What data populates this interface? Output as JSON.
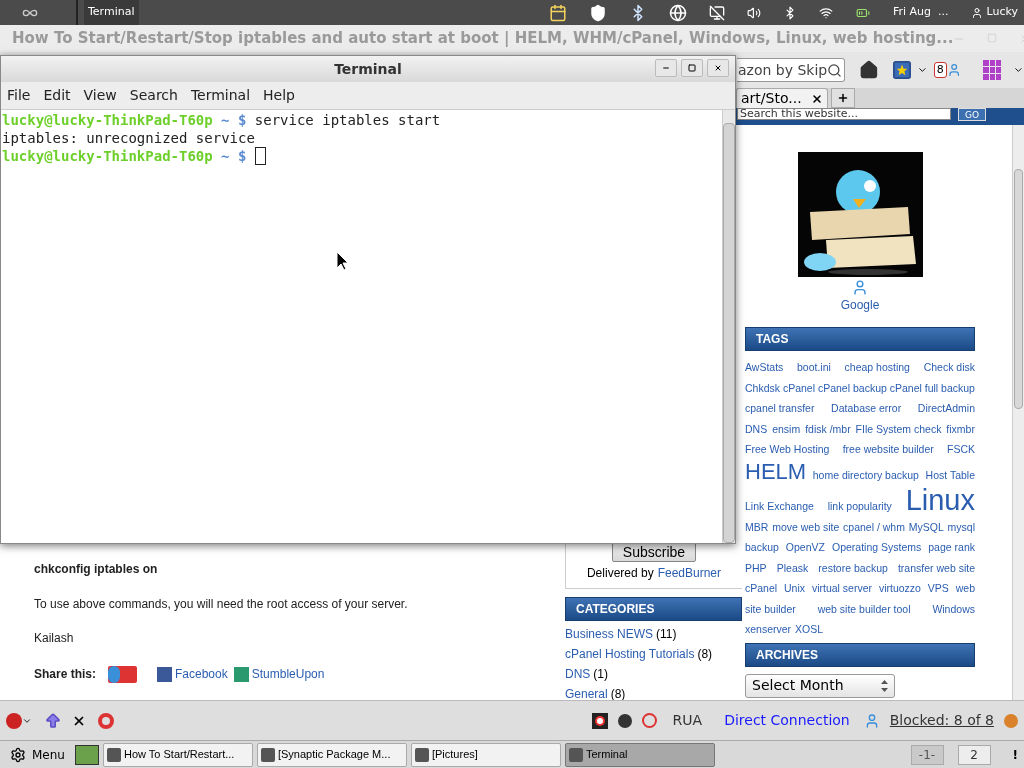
{
  "top_panel": {
    "active_app": "Terminal",
    "clock": "Fri Aug  ...",
    "user": "Lucky"
  },
  "browser": {
    "title": "How To Start/Restart/Stop iptables and auto start at boot | HELM, WHM/cPanel, Windows, Linux, web hosting...",
    "search_value": "azon by Skip",
    "badge": "8",
    "tabs": [
      {
        "label": "art/Sto...",
        "selected": true
      }
    ],
    "site_search": {
      "placeholder": "Search this website...",
      "button": "GO"
    }
  },
  "article": {
    "command": "chkconfig iptables on",
    "paragraph": "To use above commands, you will need the root access of your server.",
    "author": "Kailash",
    "share_label": "Share this:",
    "share_links": [
      "Facebook",
      "StumbleUpon"
    ]
  },
  "feed": {
    "button": "Subscribe",
    "delivered_by": "Delivered by",
    "feed_link": "FeedBurner"
  },
  "categories": {
    "heading": "CATEGORIES",
    "items": [
      {
        "name": "Business NEWS",
        "count": "(11)"
      },
      {
        "name": "cPanel Hosting Tutorials",
        "count": "(8)"
      },
      {
        "name": "DNS",
        "count": "(1)"
      },
      {
        "name": "General",
        "count": "(8)"
      }
    ]
  },
  "sidebar": {
    "follow_link": "Google",
    "tags_heading": "TAGS",
    "tag_rows": [
      [
        {
          "text": "AwStats",
          "kind": "normal"
        },
        {
          "text": "boot.ini",
          "kind": "normal"
        },
        {
          "text": "cheap hosting",
          "kind": "normal"
        },
        {
          "text": "Check disk",
          "kind": "normal"
        }
      ],
      [
        {
          "text": "Chkdsk",
          "kind": "normal"
        },
        {
          "text": "cPanel",
          "kind": "normal"
        },
        {
          "text": "cPanel backup",
          "kind": "normal"
        },
        {
          "text": "cPanel full backup",
          "kind": "normal"
        }
      ],
      [
        {
          "text": "cpanel transfer",
          "kind": "normal"
        },
        {
          "text": "Database error",
          "kind": "normal"
        },
        {
          "text": "DirectAdmin",
          "kind": "normal"
        }
      ],
      [
        {
          "text": "DNS",
          "kind": "normal"
        },
        {
          "text": "ensim",
          "kind": "normal"
        },
        {
          "text": "fdisk /mbr",
          "kind": "normal"
        },
        {
          "text": "FIle System check",
          "kind": "normal"
        },
        {
          "text": "fixmbr",
          "kind": "normal"
        }
      ],
      [
        {
          "text": "Free Web Hosting",
          "kind": "normal"
        },
        {
          "text": "free website builder",
          "kind": "normal"
        },
        {
          "text": "FSCK",
          "kind": "normal"
        }
      ],
      [
        {
          "text": "HELM",
          "kind": "large"
        },
        {
          "text": "home directory backup",
          "kind": "normal"
        },
        {
          "text": "Host Table",
          "kind": "normal"
        }
      ],
      [
        {
          "text": "Link Exchange",
          "kind": "normal"
        },
        {
          "text": "link popularity",
          "kind": "normal"
        },
        {
          "text": "Linux",
          "kind": "huge"
        }
      ],
      [
        {
          "text": "MBR",
          "kind": "normal"
        },
        {
          "text": "move web site",
          "kind": "normal"
        },
        {
          "text": "cpanel / whm",
          "kind": "normal"
        },
        {
          "text": "MySQL",
          "kind": "normal"
        },
        {
          "text": "mysql",
          "kind": "normal"
        }
      ],
      [
        {
          "text": "backup",
          "kind": "normal"
        },
        {
          "text": "OpenVZ",
          "kind": "normal"
        },
        {
          "text": "Operating Systems",
          "kind": "normal"
        },
        {
          "text": "page rank",
          "kind": "normal"
        }
      ],
      [
        {
          "text": "PHP",
          "kind": "normal"
        },
        {
          "text": "Pleask",
          "kind": "normal"
        },
        {
          "text": "restore backup",
          "kind": "normal"
        },
        {
          "text": "transfer web site",
          "kind": "normal"
        }
      ],
      [
        {
          "text": "cPanel",
          "kind": "normal"
        },
        {
          "text": "Unix",
          "kind": "normal"
        },
        {
          "text": "virtual server",
          "kind": "normal"
        },
        {
          "text": "virtuozzo",
          "kind": "normal"
        },
        {
          "text": "VPS",
          "kind": "normal"
        },
        {
          "text": "web",
          "kind": "normal"
        }
      ],
      [
        {
          "text": "site builder",
          "kind": "normal"
        },
        {
          "text": "web site builder tool",
          "kind": "normal"
        },
        {
          "text": "Windows",
          "kind": "normal"
        }
      ],
      [
        {
          "text": "xenserver",
          "kind": "normal"
        },
        {
          "text": "XOSL",
          "kind": "normal"
        }
      ]
    ],
    "archives_heading": "ARCHIVES",
    "archives_select": "Select Month"
  },
  "terminal": {
    "title": "Terminal",
    "menu": [
      "File",
      "Edit",
      "View",
      "Search",
      "Terminal",
      "Help"
    ],
    "lines": [
      {
        "kind": "prompt",
        "user": "lucky@lucky-ThinkPad-T60p",
        "path": "~ $",
        "command": "service iptables start",
        "cursor": false
      },
      {
        "kind": "output",
        "text": "iptables: unrecognized service"
      },
      {
        "kind": "prompt",
        "user": "lucky@lucky-ThinkPad-T60p",
        "path": "~ $",
        "cursor": true
      }
    ]
  },
  "addon_bar": {
    "language": "RUA",
    "connection": "Direct Connection",
    "blocked": "Blocked: 8 of 8"
  },
  "taskbar": {
    "menu": "Menu",
    "tasks": [
      {
        "label": "How To Start/Restart...",
        "selected": false
      },
      {
        "label": "[Synaptic Package M...",
        "selected": false
      },
      {
        "label": "[Pictures]",
        "selected": false
      },
      {
        "label": "Terminal",
        "selected": true
      }
    ],
    "workspaces": [
      {
        "label": "-1-",
        "selected": true
      },
      {
        "label": "2",
        "selected": false
      }
    ],
    "alert": "!"
  }
}
